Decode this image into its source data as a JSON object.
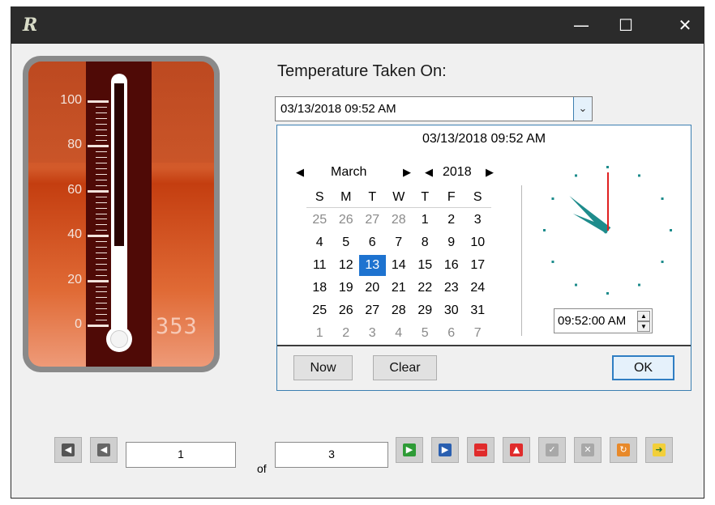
{
  "window": {
    "controls": {
      "minimize": "—",
      "maximize": "☐",
      "close": "✕"
    }
  },
  "gauge": {
    "scale_labels": [
      "100",
      "80",
      "60",
      "40",
      "20",
      "0"
    ],
    "scale_values": [
      100,
      80,
      60,
      40,
      20,
      0
    ],
    "level_value": 35.3,
    "readout": "353",
    "colors": {
      "band": "#4f0a06",
      "body": "#c24a20",
      "fill": "#ffffff"
    }
  },
  "temperature": {
    "label": "Temperature Taken On:",
    "value": "03/13/2018 09:52 AM"
  },
  "picker": {
    "header": "03/13/2018 09:52 AM",
    "month": "March",
    "year": "2018",
    "weekdays": [
      "S",
      "M",
      "T",
      "W",
      "T",
      "F",
      "S"
    ],
    "weeks": [
      [
        {
          "d": "25",
          "o": true
        },
        {
          "d": "26",
          "o": true
        },
        {
          "d": "27",
          "o": true
        },
        {
          "d": "28",
          "o": true
        },
        {
          "d": "1"
        },
        {
          "d": "2"
        },
        {
          "d": "3"
        }
      ],
      [
        {
          "d": "4"
        },
        {
          "d": "5"
        },
        {
          "d": "6"
        },
        {
          "d": "7"
        },
        {
          "d": "8"
        },
        {
          "d": "9"
        },
        {
          "d": "10"
        }
      ],
      [
        {
          "d": "11"
        },
        {
          "d": "12"
        },
        {
          "d": "13",
          "s": true
        },
        {
          "d": "14"
        },
        {
          "d": "15"
        },
        {
          "d": "16"
        },
        {
          "d": "17"
        }
      ],
      [
        {
          "d": "18"
        },
        {
          "d": "19"
        },
        {
          "d": "20"
        },
        {
          "d": "21"
        },
        {
          "d": "22"
        },
        {
          "d": "23"
        },
        {
          "d": "24"
        }
      ],
      [
        {
          "d": "25"
        },
        {
          "d": "26"
        },
        {
          "d": "27"
        },
        {
          "d": "28"
        },
        {
          "d": "29"
        },
        {
          "d": "30"
        },
        {
          "d": "31"
        }
      ],
      [
        {
          "d": "1",
          "o": true
        },
        {
          "d": "2",
          "o": true
        },
        {
          "d": "3",
          "o": true
        },
        {
          "d": "4",
          "o": true
        },
        {
          "d": "5",
          "o": true
        },
        {
          "d": "6",
          "o": true
        },
        {
          "d": "7",
          "o": true
        }
      ]
    ],
    "clock": {
      "hours": 9,
      "minutes": 52,
      "seconds": 0,
      "hand_color": "#1e8c8c",
      "second_color": "#e02020"
    },
    "time_value": "09:52:00 AM",
    "now_label": "Now",
    "clear_label": "Clear",
    "ok_label": "OK"
  },
  "navigator": {
    "position": "1",
    "of_label": "of",
    "total": "3",
    "icons": {
      "first": "first-record-icon",
      "prev": "previous-record-icon",
      "next": "next-record-icon",
      "last": "last-record-icon",
      "delete": "delete-record-icon",
      "up": "move-up-icon",
      "save": "save-icon",
      "cancel": "cancel-icon",
      "refresh": "refresh-icon",
      "export": "export-icon"
    }
  }
}
